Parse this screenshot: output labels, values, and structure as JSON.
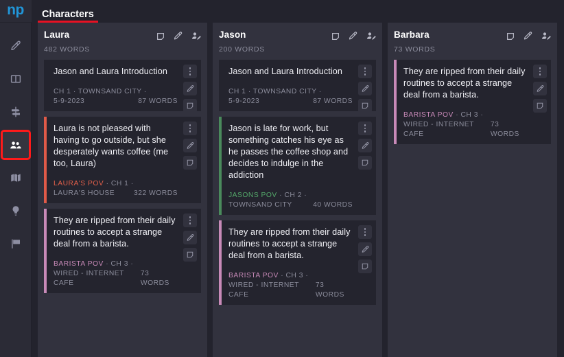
{
  "app": {
    "logo": "np",
    "logo_color": "#2196d9"
  },
  "topbar": {
    "active_tab": "Characters",
    "underline_color": "#e81123"
  },
  "sidebar": {
    "items": [
      {
        "icon": "pen-icon",
        "label": "Write",
        "selected": false
      },
      {
        "icon": "book-columns-icon",
        "label": "Outline",
        "selected": false
      },
      {
        "icon": "signpost-icon",
        "label": "Plot",
        "selected": false
      },
      {
        "icon": "people-icon",
        "label": "Characters",
        "selected": true
      },
      {
        "icon": "map-icon",
        "label": "Places",
        "selected": false
      },
      {
        "icon": "lightbulb-icon",
        "label": "Ideas",
        "selected": false
      },
      {
        "icon": "flag-icon",
        "label": "Goals",
        "selected": false
      }
    ],
    "selected_outline_color": "#ff1a1a"
  },
  "board": {
    "column_icons": [
      "note-icon",
      "pen-icon",
      "person-edit-icon"
    ],
    "card_action_icons": [
      "more-vertical-icon",
      "pen-icon",
      "note-icon"
    ],
    "columns": [
      {
        "title": "Laura",
        "word_count": "482 WORDS",
        "cards": [
          {
            "text": "Jason and Laura  Introduction",
            "pov": "",
            "pov_color": "",
            "accent": "",
            "meta_line1": "CH 1 · TOWNSAND CITY ·",
            "meta_line2": "5-9-2023",
            "words": "87 WORDS"
          },
          {
            "text": "Laura is not pleased with having to go outside, but she desperately wants coffee (me too, Laura)",
            "pov": "LAURA'S POV",
            "pov_color": "#e2604a",
            "accent": "#e05a48",
            "meta_line1_rest": " · CH 1 ·",
            "meta_line2": "LAURA'S HOUSE",
            "words": "322 WORDS"
          },
          {
            "text": "They are ripped from their daily routines to accept a strange deal from a barista.",
            "pov": "BARISTA POV",
            "pov_color": "#c88ab8",
            "accent": "#c88ab8",
            "meta_line1_rest": " · CH 3 ·",
            "meta_line2": "WIRED - INTERNET CAFE",
            "words": "73 WORDS"
          }
        ]
      },
      {
        "title": "Jason",
        "word_count": "200 WORDS",
        "cards": [
          {
            "text": "Jason and Laura  Introduction",
            "pov": "",
            "pov_color": "",
            "accent": "",
            "meta_line1": "CH 1 · TOWNSAND CITY ·",
            "meta_line2": "5-9-2023",
            "words": "87 WORDS"
          },
          {
            "text": "Jason is late for work, but something catches his eye as he passes the coffee shop and decides to indulge in the addiction",
            "pov": "JASONS POV",
            "pov_color": "#54a86a",
            "accent": "#4a8a5c",
            "meta_line1_rest": " · CH 2 ·",
            "meta_line2": "TOWNSAND CITY",
            "words": "40 WORDS"
          },
          {
            "text": "They are ripped from their daily routines to accept a strange deal from a barista.",
            "pov": "BARISTA POV",
            "pov_color": "#c88ab8",
            "accent": "#c88ab8",
            "meta_line1_rest": " · CH 3 ·",
            "meta_line2": "WIRED - INTERNET CAFE",
            "words": "73 WORDS"
          }
        ]
      },
      {
        "title": "Barbara",
        "word_count": "73 WORDS",
        "cards": [
          {
            "text": "They are ripped from their daily routines to accept a strange deal from a barista.",
            "pov": "BARISTA POV",
            "pov_color": "#c88ab8",
            "accent": "#c88ab8",
            "meta_line1_rest": " · CH 3 ·",
            "meta_line2": "WIRED - INTERNET CAFE",
            "words": "73 WORDS"
          }
        ]
      }
    ]
  }
}
